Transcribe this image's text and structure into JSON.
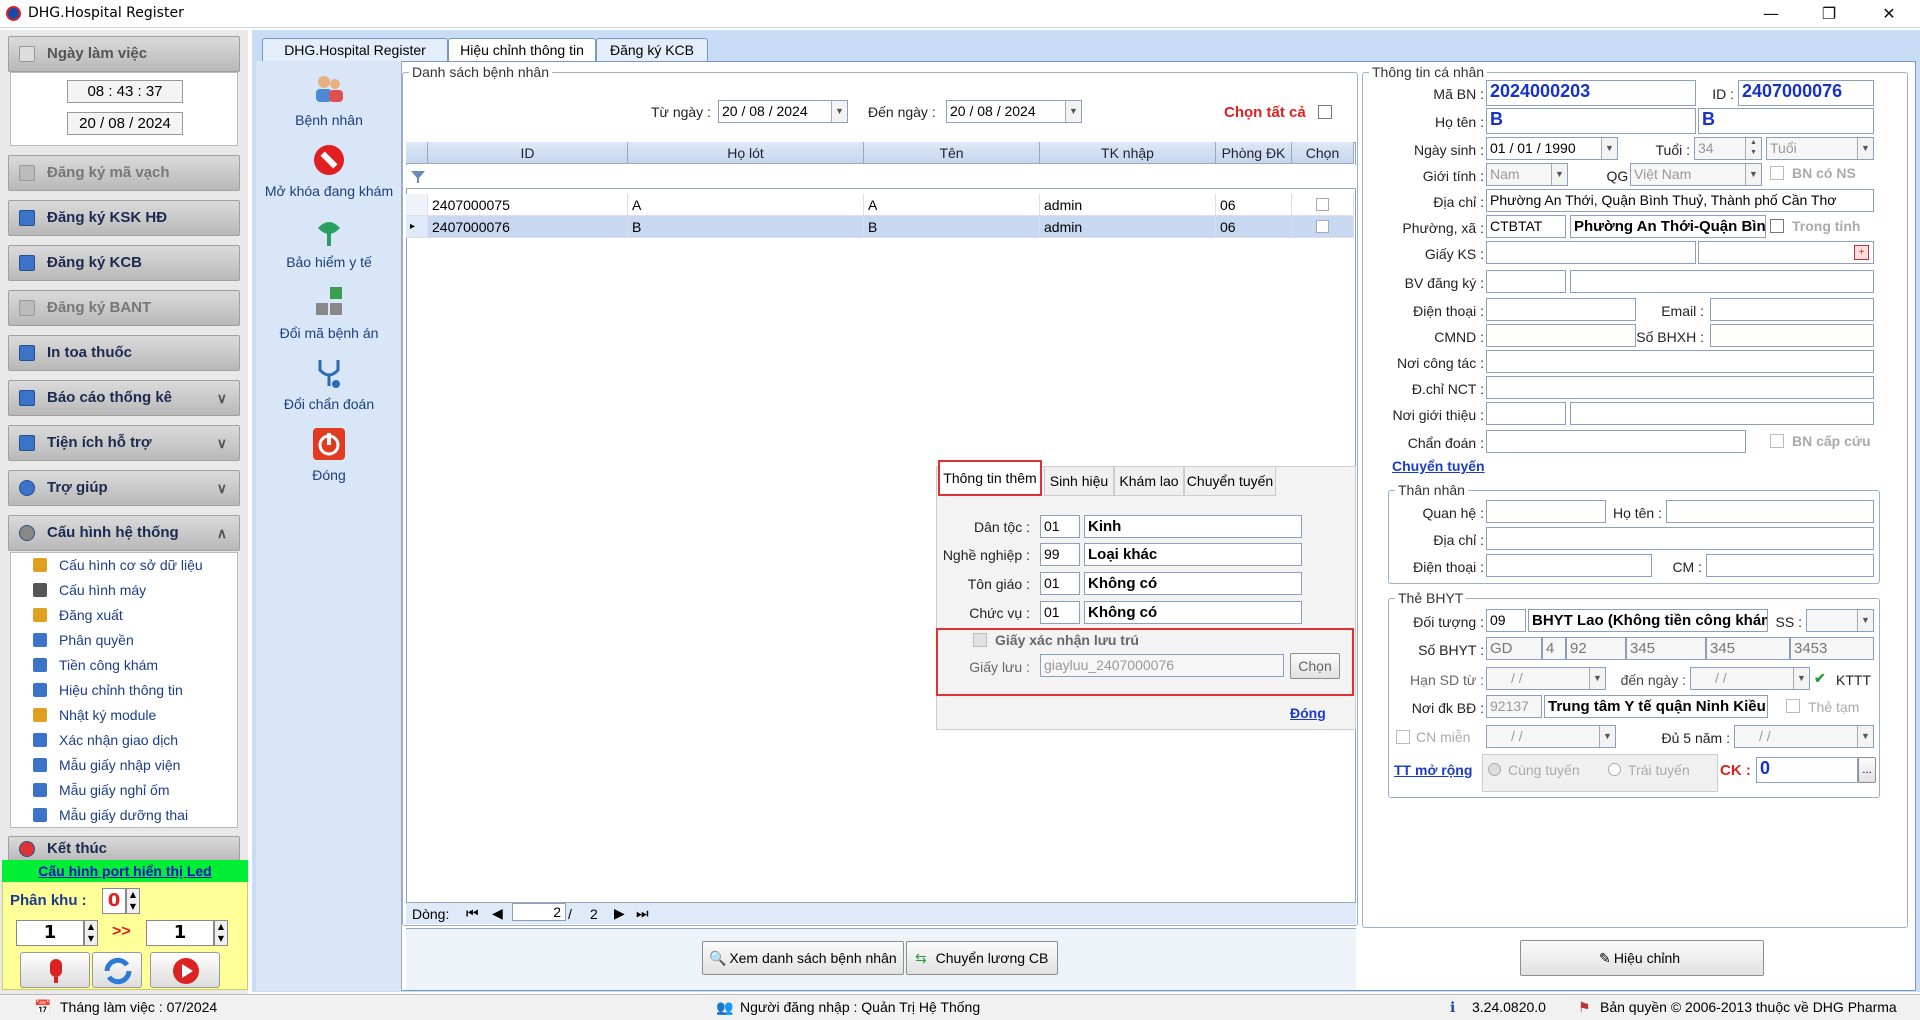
{
  "window": {
    "title": "DHG.Hospital Register"
  },
  "sidebar": {
    "ngay_lam_viec": "Ngày làm việc",
    "time": "08 : 43 : 37",
    "date": "20 / 08 / 2024",
    "sections": [
      {
        "label": "Đăng ký mã vạch",
        "disabled": true
      },
      {
        "label": "Đăng ký KSK HĐ",
        "disabled": false
      },
      {
        "label": "Đăng ký KCB",
        "disabled": false
      },
      {
        "label": "Đăng ký BANT",
        "disabled": true
      },
      {
        "label": "In toa thuốc",
        "disabled": false
      },
      {
        "label": "Báo cáo thống kê",
        "disabled": false
      },
      {
        "label": "Tiện ích hỗ trợ",
        "disabled": false
      },
      {
        "label": "Trợ giúp",
        "disabled": false
      },
      {
        "label": "Cấu hình hệ thống",
        "disabled": false
      }
    ],
    "subitems": [
      "Cấu hình cơ sở dữ liệu",
      "Cấu hình máy",
      "Đăng xuất",
      "Phân quyền",
      "Tiền công khám",
      "Hiệu chỉnh thông tin",
      "Nhật ký module",
      "Xác nhận giao dịch",
      "Mẫu giấy nhập viện",
      "Mẫu giấy nghỉ ốm",
      "Mẫu giấy dưỡng thai"
    ],
    "ket_thuc": "Kết thúc",
    "led_link": "Cấu hình port hiển thị Led",
    "phan_khu_label": "Phân khu :",
    "phan_khu_value": "0",
    "spin_left": "1",
    "spin_arrow": ">>",
    "spin_right": "1"
  },
  "tabs": [
    "DHG.Hospital Register",
    "Hiệu chỉnh thông tin",
    "Đăng ký KCB"
  ],
  "tools": [
    "Bệnh nhân",
    "Mở khóa đang khám",
    "Bảo hiểm y tế",
    "Đổi mã bệnh án",
    "Đổi chẩn đoán",
    "Đóng"
  ],
  "list": {
    "legend": "Danh sách bệnh nhân",
    "tu_ngay_label": "Từ ngày :",
    "tu_ngay": "20 / 08 / 2024",
    "den_ngay_label": "Đến  ngày :",
    "den_ngay": "20 / 08 / 2024",
    "chon_tat_ca": "Chọn tất cả",
    "columns": [
      "ID",
      "Họ lót",
      "Tên",
      "TK nhập",
      "Phòng ĐK",
      "Chọn"
    ],
    "rows": [
      {
        "id": "2407000075",
        "ho_lot": "A",
        "ten": "A",
        "tk": "admin",
        "phong": "06"
      },
      {
        "id": "2407000076",
        "ho_lot": "B",
        "ten": "B",
        "tk": "admin",
        "phong": "06"
      }
    ],
    "pager_label": "Dòng:",
    "pager_current": "2",
    "pager_total": "2",
    "pager_sep": "/"
  },
  "subpanel": {
    "tabs": [
      "Thông tin thêm",
      "Sinh hiệu",
      "Khám lao",
      "Chuyển tuyến"
    ],
    "dan_toc_label": "Dân tộc :",
    "dan_toc_code": "01",
    "dan_toc": "Kinh",
    "nghe_nghiep_label": "Nghề nghiệp :",
    "nghe_nghiep_code": "99",
    "nghe_nghiep": "Loại khác",
    "ton_giao_label": "Tôn giáo :",
    "ton_giao_code": "01",
    "ton_giao": "Không có",
    "chuc_vu_label": "Chức vụ :",
    "chuc_vu_code": "01",
    "chuc_vu": "Không có",
    "giay_xn": "Giấy xác nhận lưu trú",
    "giay_luu_label": "Giấy lưu :",
    "giay_luu": "giayluu_2407000076",
    "chon": "Chọn",
    "dong": "Đóng"
  },
  "buttons": {
    "xem_ds": "Xem danh sách bệnh nhân",
    "chuyen_luong": "Chuyển lương CB",
    "hieu_chinh": "Hiệu chỉnh"
  },
  "info": {
    "legend": "Thông tin cá nhân",
    "ma_bn_label": "Mã BN :",
    "ma_bn": "2024000203",
    "id_label": "ID :",
    "id": "2407000076",
    "ho_ten_label": "Họ tên :",
    "ho": "B",
    "ten": "B",
    "ngay_sinh_label": "Ngày sinh :",
    "ngay_sinh": "01 / 01 / 1990",
    "tuoi_label": "Tuổi :",
    "tuoi": "34",
    "tuoi_unit": "Tuổi",
    "gioi_tinh_label": "Giới tính :",
    "gioi_tinh": "Nam",
    "qg_label": "QG :",
    "qg": "Việt Nam",
    "bn_co_ns": "BN có NS",
    "dia_chi_label": "Địa chỉ :",
    "dia_chi": "Phường An Thới, Quận Bình Thuỷ, Thành phố Cần Thơ",
    "phuong_xa_label": "Phường, xã :",
    "phuong_code": "CTBTAT",
    "phuong": "Phường An Thới-Quận Bình",
    "trong_tinh": "Trong tỉnh",
    "giay_ks_label": "Giấy KS :",
    "bv_dang_ky_label": "BV đăng ký :",
    "dien_thoai_label": "Điện thoại :",
    "email_label": "Email :",
    "cmnd_label": "CMND :",
    "so_bhxh_label": "Số BHXH :",
    "noi_cong_tac_label": "Nơi công tác :",
    "dchi_nct_label": "Đ.chỉ NCT :",
    "noi_gioi_thieu_label": "Nơi giới thiệu :",
    "chan_doan_label": "Chẩn đoán :",
    "bn_cap_cuu": "BN cấp cứu",
    "chuyen_tuyen": "Chuyển tuyến"
  },
  "than_nhan": {
    "legend": "Thân nhân",
    "quan_he_label": "Quan hệ :",
    "ho_ten_label": "Họ tên :",
    "dia_chi_label": "Địa chỉ :",
    "dien_thoai_label": "Điện thoại :",
    "cm_label": "CM :"
  },
  "bhyt": {
    "legend": "Thẻ BHYT",
    "doi_tuong_label": "Đối tượng :",
    "doi_tuong_code": "09",
    "doi_tuong": "BHYT Lao (Không tiền công khám)",
    "ss_label": "SS :",
    "so_bhyt_label": "Số BHYT :",
    "so": [
      "GD",
      "4",
      "92",
      "345",
      "345",
      "3453"
    ],
    "han_sd_label": "Hạn SD từ :",
    "han_sd_from": "/ /",
    "den_ngay_label": "đến  ngày :",
    "han_sd_to": "/ /",
    "kttt": "KTTT",
    "noi_dk_label": "Nơi đk BĐ :",
    "noi_dk_code": "92137",
    "noi_dk": "Trung tâm Y tế quận Ninh Kiều",
    "the_tam": "Thẻ tạm",
    "cn_mien": "CN miễn",
    "cn_mien_date": "/ /",
    "du5_label": "Đủ 5 năm :",
    "du5_date": "/ /",
    "tt_mo_rong": "TT mở rộng",
    "cung_tuyen": "Cùng tuyến",
    "trai_tuyen": "Trái tuyến",
    "ck_label": "CK :",
    "ck": "0",
    "ck_btn": "..."
  },
  "status": {
    "thang": "Tháng làm việc : 07/2024",
    "nguoi_dn": "Người đăng nhập : Quản Trị Hệ Thống",
    "version": "3.24.0820.0",
    "copyright": "Bản quyền © 2006-2013 thuộc về DHG Pharma"
  }
}
